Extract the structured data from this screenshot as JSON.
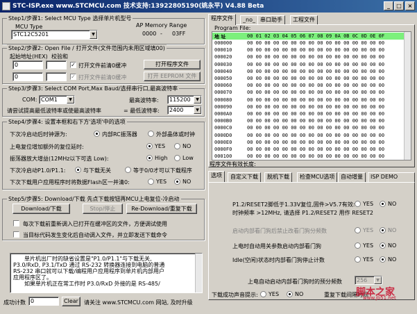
{
  "window": {
    "title": "STC-ISP.exe    www.STCMCU.com   技术支持:13922805190(姚永平)   V4.88 Beta"
  },
  "step1": {
    "legend": "Step1/步骤1: Select MCU Type  选择单片机型号",
    "mcu_label": "MCU Type",
    "mem_label": "AP Memory Range",
    "mcu_value": "STC12C5201",
    "range_start": "0000",
    "range_sep": "-",
    "range_end": "03FF"
  },
  "step2": {
    "legend": "Step2/步骤2: Open File / 打开文件(文件范围内未用区域填00)",
    "addr_label": "起始地址(HEX)",
    "checksum_label": "校验和",
    "addr1": "0",
    "addr2": "0",
    "sum1": "",
    "sum2": "",
    "clear_buf1": "打开文件前清0缓冲",
    "clear_buf2": "打开文件前清0缓冲",
    "open_prog_btn": "打开程序文件",
    "open_eeprom_btn": "打开 EEPROM 文件"
  },
  "step3": {
    "legend": "Step3/步骤3: Select COM Port,Max Baud/选择串行口,最高波特率",
    "com_label": "COM:",
    "com_value": "COM1",
    "max_baud_label": "最高波特率:",
    "max_baud_value": "115200",
    "retry_label": "请尝试提高最低波特率或使最高波特率",
    "min_baud_label": "= 最低波特率:",
    "min_baud_value": "2400"
  },
  "step4": {
    "legend": "Step4/步骤4: 设置本框和右下方'选项'中的选项",
    "r1_label": "下次冷启动后时钟源为:",
    "r1_opt1": "内部RC振荡器",
    "r1_opt2": "外部晶体或时钟",
    "r2_label": "上电复位增加额外的复位延时:",
    "r2_opt1": "YES",
    "r2_opt2": "NO",
    "r3_label": "振荡器放大增益(12MHz以下可选 Low):",
    "r3_opt1": "High",
    "r3_opt2": "Low",
    "r4_label": "下次冷启动P1.0/P1.1:",
    "r4_opt1": "与下载无关",
    "r4_opt2": "等于0/0才可以下载程序",
    "r5_label": "下次下载用户应用程序时将数据Flash区一并清0:",
    "r5_opt1": "YES",
    "r5_opt2": "NO"
  },
  "step5": {
    "legend": "Step5/步骤5: Download/下载  先点下载按钮再MCU上电复位-冷启动",
    "download_btn": "Download/下载",
    "stop_btn": "Stop/停止",
    "redownload_btn": "Re-Download/重复下载",
    "chk1": "每次下载前重新调入已打开在缓冲区的文件，方便调试使用",
    "chk2": "当目标代码发生变化后自动调入文件，并立即发送下载命令"
  },
  "notes": {
    "line1": "单片机出厂时的缺省设置是\"P1.0/P1.1\"与下载无关,",
    "line2": "P3.0/RxD, P3.1/TxD 通过 RS-232 转换器连接到电脑的普通",
    "line3": "RS-232 串口就可以下载/编程用户应用程序到单片机内部用户",
    "line4": "应用程序区了。",
    "line5": "如果单片机正在常工作时 P3.0/RxD 外接的是 RS-485/"
  },
  "bottom": {
    "success_label": "成功计数",
    "success_value": "0",
    "clear_btn": "Clear",
    "follow_text": "请关注 www.STCMCU.com 网站, 及时升级"
  },
  "right": {
    "tabs": [
      "程序文件",
      "_no_",
      "串口助手",
      "工程文件"
    ],
    "file_label": "Program File:",
    "header_addr": "地 址",
    "header_cols": "00 01 02 03 04 05 06 07 08 09 0A 0B 0C 0D 0E 0F",
    "rows": [
      {
        "addr": "000000",
        "data": "00 00 00 00 00 00 00 00 00 00 00 00 00 00 00 00"
      },
      {
        "addr": "000010",
        "data": "00 00 00 00 00 00 00 00 00 00 00 00 00 00 00 00"
      },
      {
        "addr": "000020",
        "data": "00 00 00 00 00 00 00 00 00 00 00 00 00 00 00 00"
      },
      {
        "addr": "000030",
        "data": "00 00 00 00 00 00 00 00 00 00 00 00 00 00 00 00"
      },
      {
        "addr": "000040",
        "data": "00 00 00 00 00 00 00 00 00 00 00 00 00 00 00 00"
      },
      {
        "addr": "000050",
        "data": "00 00 00 00 00 00 00 00 00 00 00 00 00 00 00 00"
      },
      {
        "addr": "000060",
        "data": "00 00 00 00 00 00 00 00 00 00 00 00 00 00 00 00"
      },
      {
        "addr": "000070",
        "data": "00 00 00 00 00 00 00 00 00 00 00 00 00 00 00 00"
      },
      {
        "addr": "000080",
        "data": "00 00 00 00 00 00 00 00 00 00 00 00 00 00 00 00"
      },
      {
        "addr": "000090",
        "data": "00 00 00 00 00 00 00 00 00 00 00 00 00 00 00 00"
      },
      {
        "addr": "0000A0",
        "data": "00 00 00 00 00 00 00 00 00 00 00 00 00 00 00 00"
      },
      {
        "addr": "0000B0",
        "data": "00 00 00 00 00 00 00 00 00 00 00 00 00 00 00 00"
      },
      {
        "addr": "0000C0",
        "data": "00 00 00 00 00 00 00 00 00 00 00 00 00 00 00 00"
      },
      {
        "addr": "0000D0",
        "data": "00 00 00 00 00 00 00 00 00 00 00 00 00 00 00 00"
      },
      {
        "addr": "0000E0",
        "data": "00 00 00 00 00 00 00 00 00 00 00 00 00 00 00 00"
      },
      {
        "addr": "0000F0",
        "data": "00 00 00 00 00 00 00 00 00 00 00 00 00 00 00 00"
      },
      {
        "addr": "000100",
        "data": "00 00 00 00 00 00 00 00 00 00 00 00 00 00 00 00"
      }
    ],
    "length_label": "程序文件有效长度:",
    "opt_tabs": [
      "选项",
      "自定义下载",
      "脱机下载",
      "检查MCU选项",
      "自动增量",
      "ISP DEMO"
    ],
    "opt1_label": "P1.2/RESET2脚低于1.33V复位,固件>V5.7有效:",
    "opt1_yes": "YES",
    "opt1_no": "NO",
    "opt1b": "时钟频率 >12MHz, 请选择 P1.2/RESET2 用作 RESET2",
    "opt2_label": "启动内部看门狗后禁止改看门狗分频数",
    "opt2_yes": "YES",
    "opt2_no": "NO",
    "opt3_label": "上电时自动用关参数启动内部看门狗",
    "opt3_yes": "YES",
    "opt3_no": "NO",
    "opt4_label": "Idle(空闲)状态时内部看门狗停止计数",
    "opt4_yes": "YES",
    "opt4_no": "NO",
    "opt5_label": "上电自动启动内部看门狗时的预分频数",
    "opt5_value": "256",
    "beep_label": "下载成功声音提示:",
    "beep_yes": "YES",
    "beep_no": "NO",
    "recount_label": "重复下载间隔时间",
    "watermark": "脚本之家",
    "watermark_url": "www.jb51.net"
  }
}
